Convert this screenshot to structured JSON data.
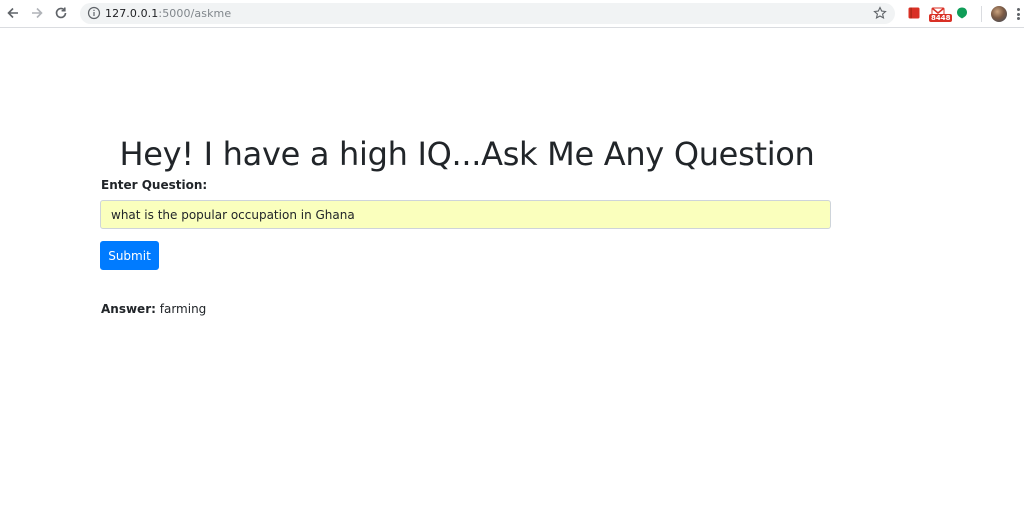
{
  "browser": {
    "url_host": "127.0.0.1",
    "url_path": ":5000/askme",
    "mail_badge": "8448",
    "icons": {
      "back": "arrow-left-icon",
      "forward": "arrow-right-icon",
      "reload": "reload-icon",
      "info": "info-icon",
      "bookmark": "star-icon",
      "ext1": "red-book-icon",
      "ext2": "gmail-icon",
      "ext3": "green-leaf-icon",
      "profile": "avatar",
      "menu": "kebab-menu-icon"
    }
  },
  "page": {
    "title": "Hey! I have a high IQ...Ask Me Any Question",
    "question_label": "Enter Question:",
    "question_value": "what is the popular occupation in Ghana",
    "submit_label": "Submit",
    "answer_label": "Answer:",
    "answer_value": "farming"
  },
  "colors": {
    "primary": "#007bff",
    "autofill_bg": "#faffbd",
    "text": "#212529"
  }
}
